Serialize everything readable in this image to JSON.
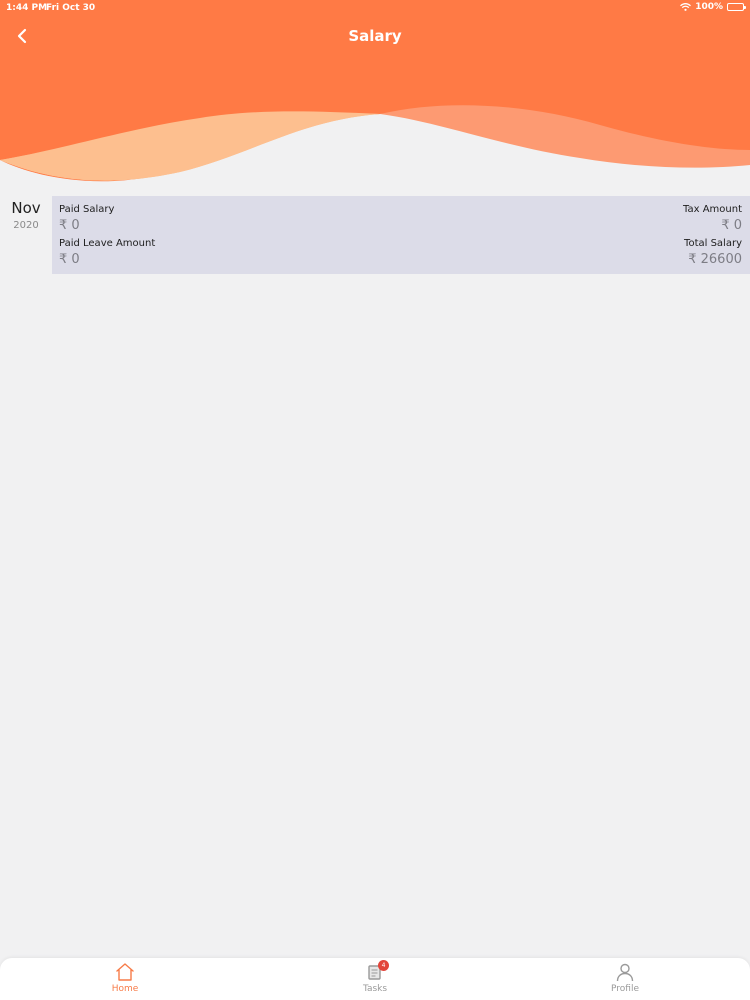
{
  "status_bar": {
    "time": "1:44 PM",
    "date": "Fri Oct 30",
    "battery": "100%"
  },
  "header": {
    "title": "Salary",
    "back_icon": "chevron-left-icon"
  },
  "colors": {
    "header_primary": "#ff7a45",
    "wave_light": "#fdbf8f",
    "wave_mid": "#fd9a72",
    "card_bg": "#dcdce8",
    "accent": "#f77b48",
    "badge": "#e2453a"
  },
  "records": [
    {
      "month": "Nov",
      "year": "2020",
      "paid_salary_label": "Paid Salary",
      "paid_salary_value": "₹ 0",
      "tax_amount_label": "Tax Amount",
      "tax_amount_value": "₹ 0",
      "paid_leave_label": "Paid Leave Amount",
      "paid_leave_value": "₹ 0",
      "total_salary_label": "Total Salary",
      "total_salary_value": "₹ 26600"
    }
  ],
  "tab_bar": {
    "home": {
      "label": "Home",
      "icon": "home-icon"
    },
    "tasks": {
      "label": "Tasks",
      "icon": "tasks-icon",
      "badge": "4"
    },
    "profile": {
      "label": "Profile",
      "icon": "user-icon"
    }
  }
}
